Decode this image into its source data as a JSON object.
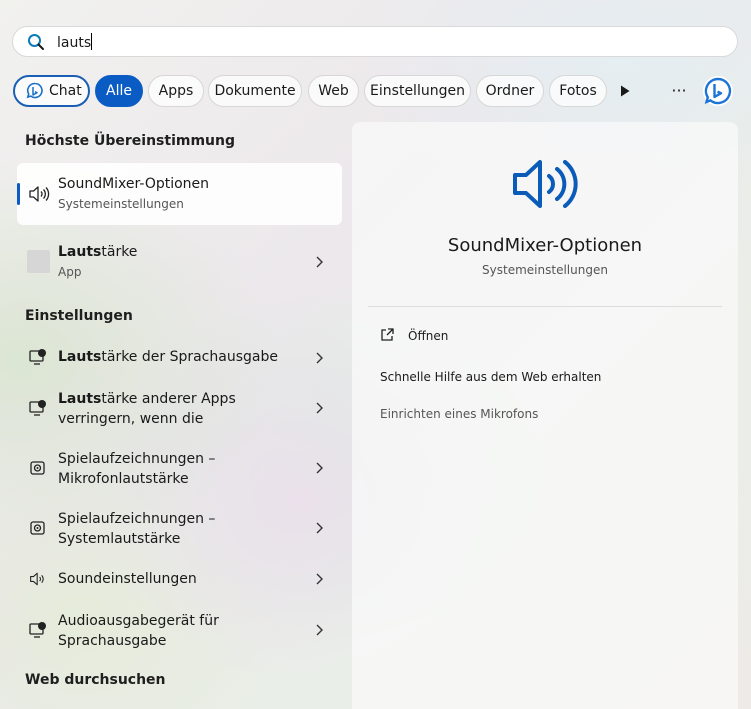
{
  "search": {
    "query": "lauts"
  },
  "filters": {
    "chips": [
      {
        "label": "Chat"
      },
      {
        "label": "Alle"
      },
      {
        "label": "Apps"
      },
      {
        "label": "Dokumente"
      },
      {
        "label": "Web"
      },
      {
        "label": "Einstellungen"
      },
      {
        "label": "Ordner"
      },
      {
        "label": "Fotos"
      }
    ],
    "more_label": "···",
    "accent_color": "#0a5cc4"
  },
  "best_match": {
    "heading": "Höchste Übereinstimmung",
    "title": "SoundMixer-Optionen",
    "subtitle": "Systemeinstellungen"
  },
  "apps_result": {
    "title_bold": "Lauts",
    "title_rest": "tärke",
    "subtitle": "App"
  },
  "settings": {
    "heading": "Einstellungen",
    "items": [
      {
        "bold": "Lauts",
        "line1": "tärke der Sprachausgabe",
        "line2": ""
      },
      {
        "bold": "Lauts",
        "line1": "tärke anderer Apps",
        "line2": "verringern, wenn die"
      },
      {
        "bold": "",
        "line1": "Spielaufzeichnungen –",
        "line2": "Mikrofonlautstärke"
      },
      {
        "bold": "",
        "line1": "Spielaufzeichnungen –",
        "line2": "Systemlautstärke"
      },
      {
        "bold": "",
        "line1": "Soundeinstellungen",
        "line2": ""
      },
      {
        "bold": "",
        "line1": "Audioausgabegerät für",
        "line2": "Sprachausgabe"
      }
    ]
  },
  "web": {
    "heading": "Web durchsuchen"
  },
  "detail": {
    "title": "SoundMixer-Optionen",
    "subtitle": "Systemeinstellungen",
    "actions": {
      "open": "Öffnen",
      "help": "Schnelle Hilfe aus dem Web erhalten",
      "mic": "Einrichten eines Mikrofons"
    }
  }
}
